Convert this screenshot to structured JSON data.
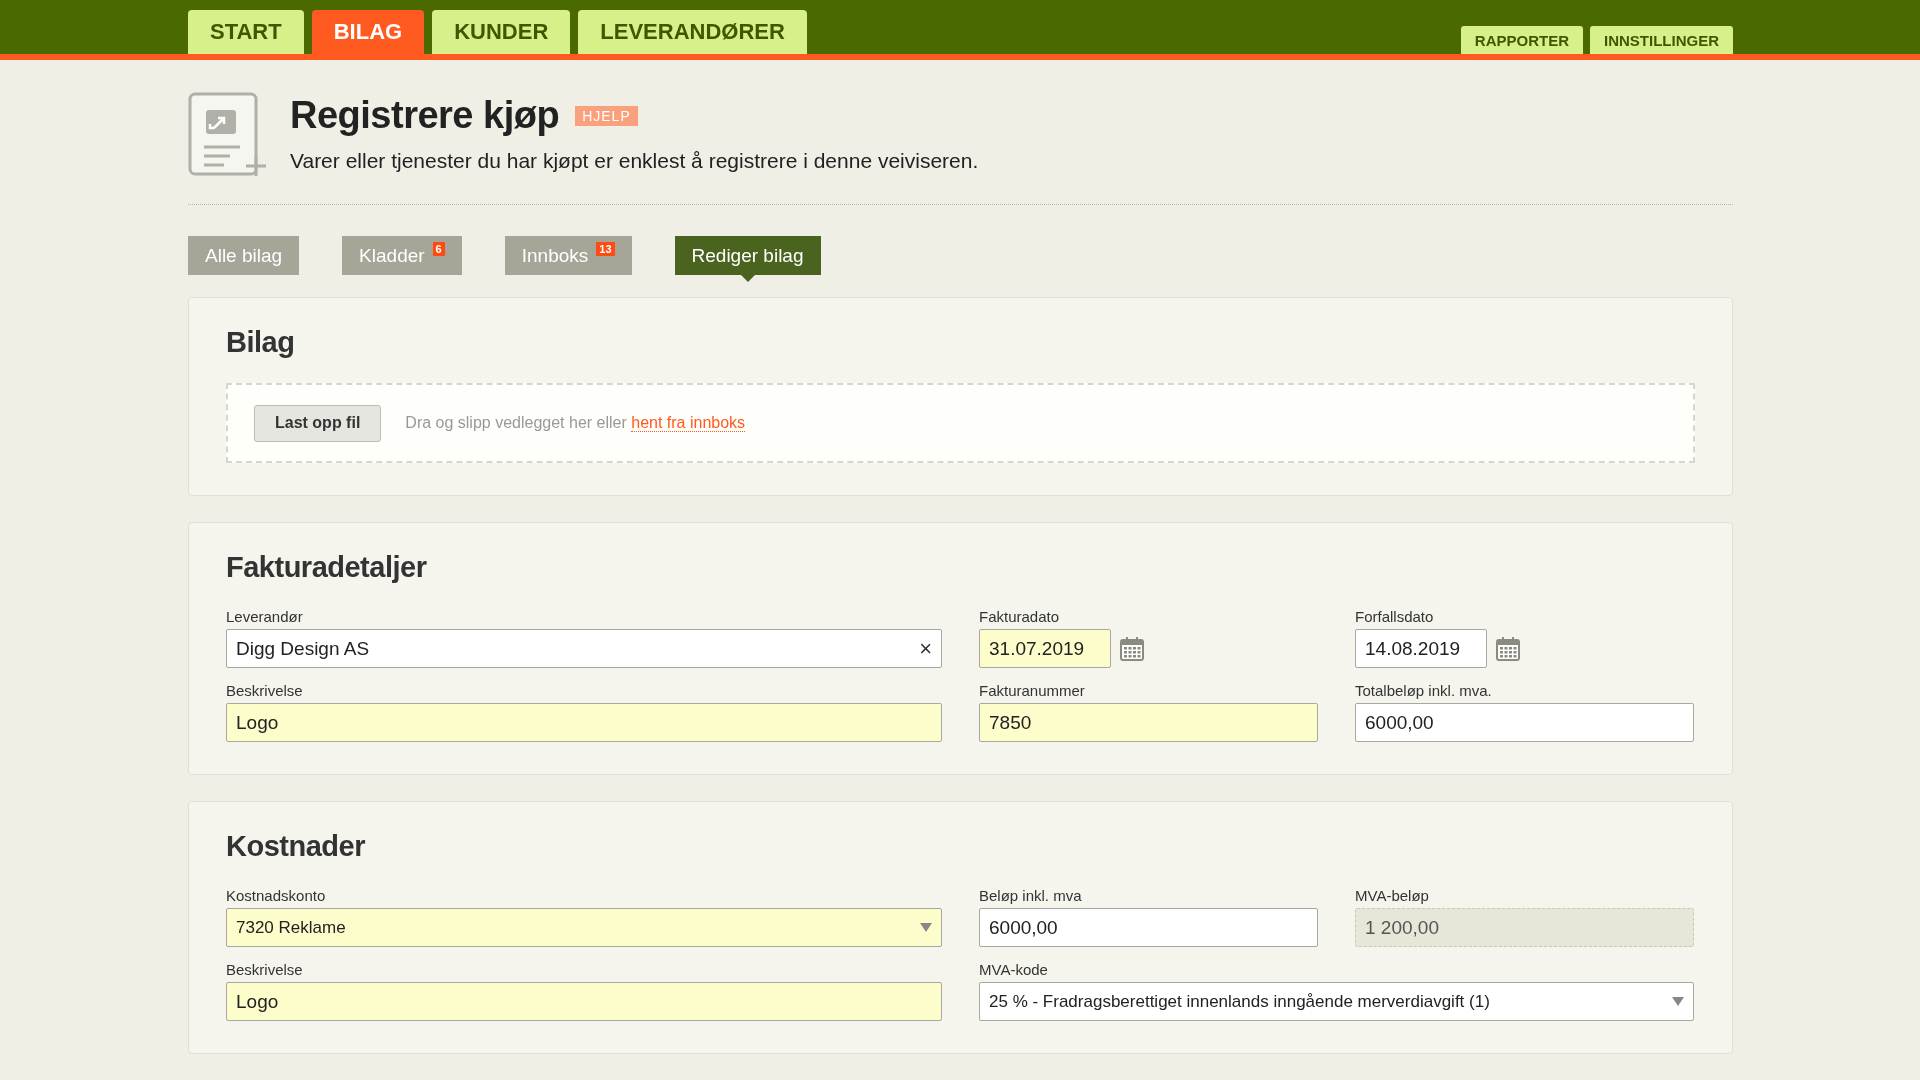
{
  "nav": {
    "tabs": [
      {
        "label": "START",
        "selected": false
      },
      {
        "label": "BILAG",
        "selected": true
      },
      {
        "label": "KUNDER",
        "selected": false
      },
      {
        "label": "LEVERANDØRER",
        "selected": false
      }
    ],
    "utility_links": [
      "RAPPORTER",
      "INNSTILLINGER"
    ]
  },
  "page": {
    "title": "Registrere kjøp",
    "help_badge": "HJELP",
    "subtitle": "Varer eller tjenester du har kjøpt er enklest å registrere i denne veiviseren."
  },
  "subtabs": [
    {
      "label": "Alle bilag",
      "selected": false
    },
    {
      "label": "Kladder",
      "badge": "6",
      "selected": false
    },
    {
      "label": "Innboks",
      "badge": "13",
      "selected": false
    },
    {
      "label": "Rediger bilag",
      "selected": true
    }
  ],
  "sections": [
    {
      "kind": "upload",
      "title": "Bilag",
      "button": "Last opp fil",
      "hint": "Dra og slipp vedlegget her eller",
      "link": "hent fra innboks"
    },
    {
      "kind": "fields",
      "title": "Fakturadetaljer",
      "rows": [
        [
          {
            "kind": "clearable",
            "label": "Leverandør",
            "value": "Digg Design AS",
            "highlighted": false,
            "clear": "×"
          },
          {
            "kind": "date",
            "label": "Fakturadato",
            "value": "31.07.2019",
            "highlighted": true
          },
          {
            "kind": "date",
            "label": "Forfallsdato",
            "value": "14.08.2019",
            "highlighted": false
          }
        ],
        [
          {
            "kind": "text",
            "label": "Beskrivelse",
            "value": "Logo",
            "highlighted": true
          },
          {
            "kind": "text",
            "label": "Fakturanummer",
            "value": "7850",
            "highlighted": true
          },
          {
            "kind": "text",
            "label": "Totalbeløp inkl. mva.",
            "value": "6000,00",
            "highlighted": false
          }
        ]
      ]
    },
    {
      "kind": "fields",
      "title": "Kostnader",
      "rows": [
        [
          {
            "kind": "select",
            "label": "Kostnadskonto",
            "value": "7320 Reklame",
            "highlighted": true
          },
          {
            "kind": "text",
            "label": "Beløp inkl. mva",
            "value": "6000,00",
            "highlighted": false
          },
          {
            "kind": "readonly",
            "label": "MVA-beløp",
            "value": "1 200,00"
          }
        ],
        [
          {
            "kind": "text",
            "label": "Beskrivelse",
            "value": "Logo",
            "highlighted": true
          },
          {
            "kind": "select",
            "wide": true,
            "label": "MVA-kode",
            "value": "25 % - Fradragsberettiget innenlands inngående merverdiavgift (1)",
            "highlighted": false
          }
        ]
      ]
    }
  ]
}
